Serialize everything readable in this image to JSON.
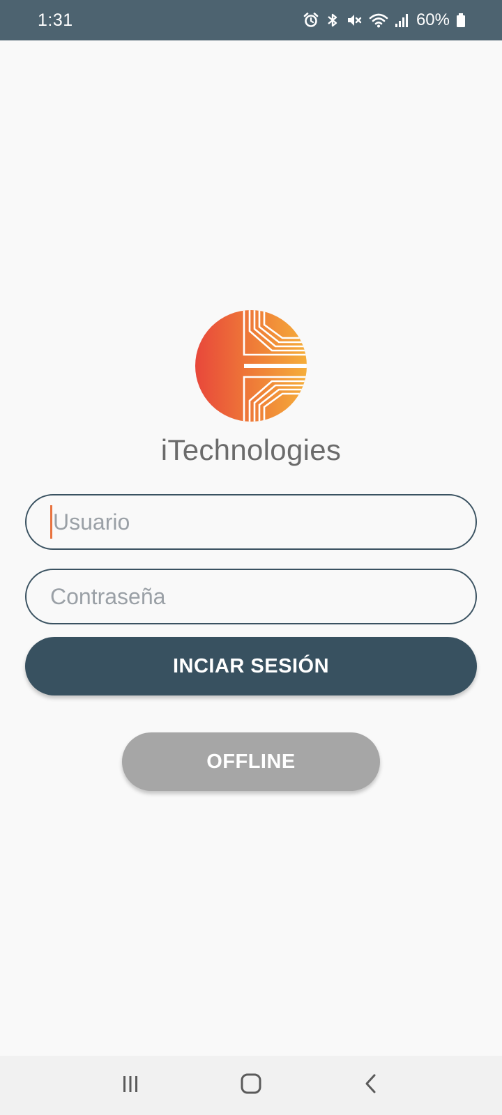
{
  "status_bar": {
    "time": "1:31",
    "battery": "60%",
    "icons": [
      "alarm-icon",
      "bluetooth-icon",
      "mute-icon",
      "wifi-icon",
      "signal-icon",
      "battery-icon"
    ]
  },
  "brand": {
    "name": "iTechnologies",
    "logo_colors": [
      "#e8473a",
      "#f5ae3a"
    ]
  },
  "login_form": {
    "username_placeholder": "Usuario",
    "password_placeholder": "Contraseña",
    "login_label": "INCIAR SESIÓN",
    "offline_label": "OFFLINE"
  },
  "colors": {
    "primary": "#385160",
    "secondary_button": "#a6a6a6",
    "status_bar": "#4d6370",
    "caret": "#e8733f"
  },
  "nav_bar": {
    "icons": [
      "recent-apps-icon",
      "home-icon",
      "back-icon"
    ]
  }
}
